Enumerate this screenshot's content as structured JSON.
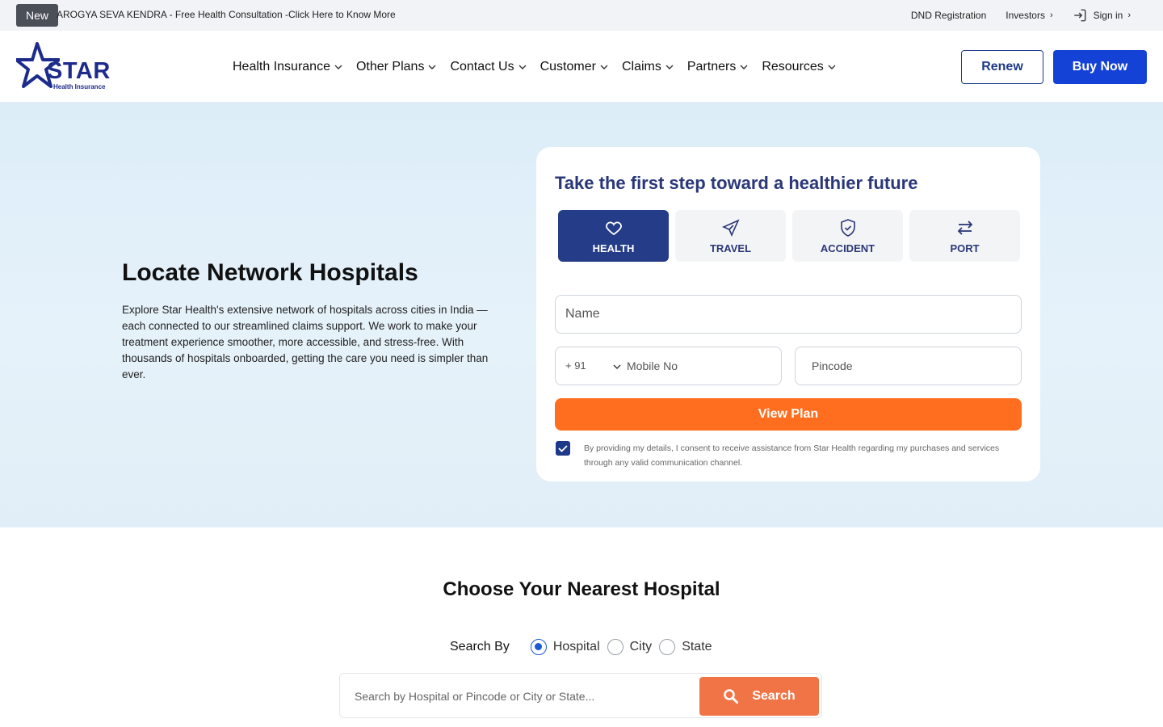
{
  "topbar": {
    "badge": "New",
    "announcement": "AROGYA SEVA KENDRA - Free Health Consultation -Click Here to Know More",
    "links": [
      "DND Registration",
      "Investors",
      "Sign in"
    ]
  },
  "header": {
    "logo_text": "STAR",
    "logo_sub": "Health Insurance",
    "nav": [
      "Health Insurance",
      "Other Plans",
      "Contact Us",
      "Customer",
      "Claims",
      "Partners",
      "Resources"
    ],
    "renew_label": "Renew",
    "buy_label": "Buy Now"
  },
  "hero": {
    "title": "Locate Network Hospitals",
    "description": "Explore Star Health's extensive network of hospitals across cities in India — each connected to our streamlined claims support. We work to make your treatment experience smoother, more accessible, and stress-free. With thousands of hospitals onboarded, getting the care you need is simpler than ever."
  },
  "form": {
    "title": "Take the first step toward a healthier future",
    "tabs": [
      {
        "label": "HEALTH",
        "icon": "heart-icon",
        "active": true
      },
      {
        "label": "TRAVEL",
        "icon": "plane-icon",
        "active": false
      },
      {
        "label": "ACCIDENT",
        "icon": "shield-icon",
        "active": false
      },
      {
        "label": "PORT",
        "icon": "swap-arrows-icon",
        "active": false
      }
    ],
    "name_placeholder": "Name",
    "country_code": "+ 91",
    "mobile_placeholder": "Mobile No",
    "pincode_placeholder": "Pincode",
    "submit_label": "View Plan",
    "consent_text": "By providing my details, I consent to receive assistance from Star Health regarding my purchases and services through any valid communication channel."
  },
  "search": {
    "title": "Choose Your Nearest Hospital",
    "search_by_label": "Search By",
    "options": [
      "Hospital",
      "City",
      "State"
    ],
    "selected": "Hospital",
    "placeholder": "Search by Hospital or Pincode or City or State...",
    "button_label": "Search"
  },
  "colors": {
    "brand_navy": "#1d2b8c",
    "primary_blue": "#1542d6",
    "orange": "#ff6d1f",
    "search_orange": "#f07446",
    "hero_bg": "#dcedf8"
  }
}
